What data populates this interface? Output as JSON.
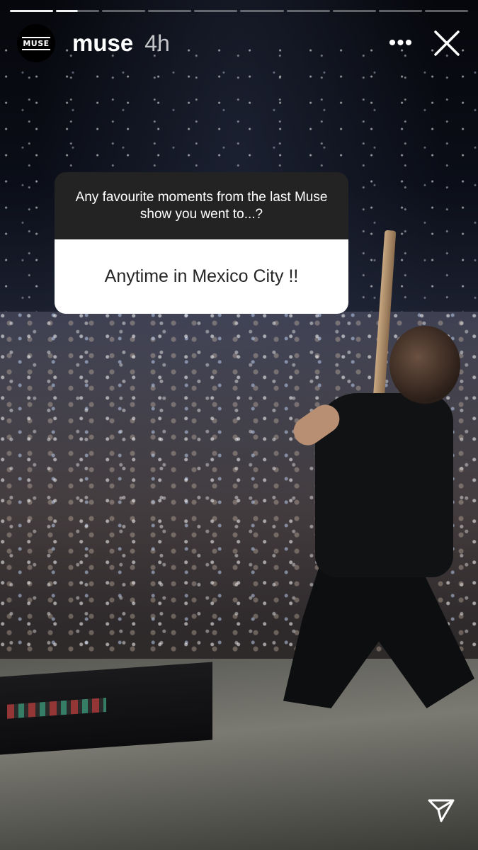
{
  "story": {
    "progress": {
      "total_segments": 10,
      "current_segment": 2,
      "current_segment_progress": 0.5
    },
    "header": {
      "avatar_text": "MUSE",
      "username": "muse",
      "time_ago": "4h",
      "more_icon": "ellipsis-icon",
      "close_icon": "close-icon"
    },
    "question_sticker": {
      "prompt": "Any favourite moments from the last Muse show you went to...?",
      "answer": "Anytime in Mexico City !!"
    },
    "footer": {
      "share_icon": "send-icon"
    }
  }
}
